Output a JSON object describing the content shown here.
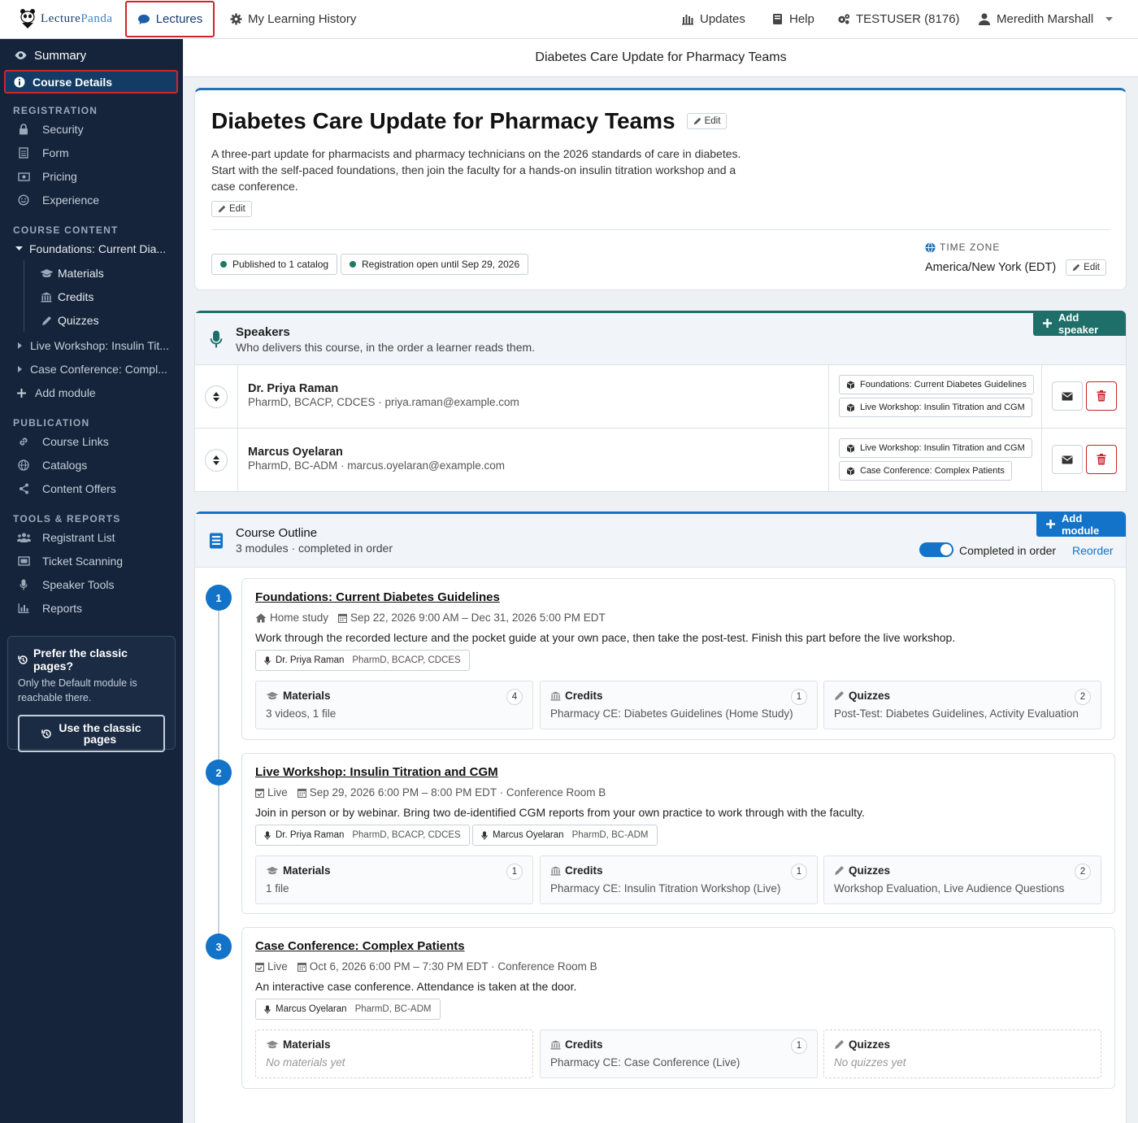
{
  "brand": {
    "logo_a": "Lecture",
    "logo_b": "Panda"
  },
  "topnav": {
    "lectures": "Lectures",
    "history": "My Learning History",
    "updates": "Updates",
    "help": "Help",
    "account": "TESTUSER (8176)",
    "user": "Meredith Marshall"
  },
  "sidebar": {
    "summary": "Summary",
    "course_details": "Course Details",
    "registration_head": "REGISTRATION",
    "registration": [
      "Security",
      "Form",
      "Pricing",
      "Experience"
    ],
    "content_head": "COURSE CONTENT",
    "module1": "Foundations: Current Dia...",
    "module1_children": [
      "Materials",
      "Credits",
      "Quizzes"
    ],
    "module2": "Live Workshop: Insulin Tit...",
    "module3": "Case Conference: Compl...",
    "add_module": "Add module",
    "publication_head": "PUBLICATION",
    "publication": [
      "Course Links",
      "Catalogs",
      "Content Offers"
    ],
    "tools_head": "TOOLS & REPORTS",
    "tools": [
      "Registrant List",
      "Ticket Scanning",
      "Speaker Tools",
      "Reports"
    ],
    "classic_title": "Prefer the classic pages?",
    "classic_desc": "Only the Default module is reachable there.",
    "classic_btn_1": "Use the classic",
    "classic_btn_2": "pages"
  },
  "page_title": "Diabetes Care Update for Pharmacy Teams",
  "course": {
    "title": "Diabetes Care Update for Pharmacy Teams",
    "edit": "Edit",
    "description": "A three-part update for pharmacists and pharmacy technicians on the 2026 standards of care in diabetes. Start with the self-paced foundations, then join the faculty for a hands-on insulin titration workshop and a case conference.",
    "published": "Published to 1 catalog",
    "registration": "Registration open until Sep 29, 2026",
    "tz_label": "TIME ZONE",
    "tz_value": "America/New York (EDT)"
  },
  "speakers": {
    "title": "Speakers",
    "subtitle": "Who delivers this course, in the order a learner reads them.",
    "add": "Add speaker",
    "list": [
      {
        "name": "Dr. Priya Raman",
        "meta": "PharmD, BCACP, CDCES · priya.raman@example.com",
        "modules": [
          "Foundations: Current Diabetes Guidelines",
          "Live Workshop: Insulin Titration and CGM"
        ]
      },
      {
        "name": "Marcus Oyelaran",
        "meta": "PharmD, BC-ADM · marcus.oyelaran@example.com",
        "modules": [
          "Live Workshop: Insulin Titration and CGM",
          "Case Conference: Complex Patients"
        ]
      }
    ]
  },
  "outline": {
    "title": "Course Outline",
    "subtitle": "3 modules · completed in order",
    "add": "Add module",
    "toggle_label": "Completed in order",
    "reorder": "Reorder",
    "modules": [
      {
        "num": "1",
        "title": "Foundations: Current Diabetes Guidelines",
        "type": "Home study",
        "when": "Sep 22, 2026 9:00 AM – Dec 31, 2026 5:00 PM EDT",
        "desc": "Work through the recorded lecture and the pocket guide at your own pace, then take the post-test. Finish this part before the live workshop.",
        "speakers": [
          {
            "name": "Dr. Priya Raman",
            "cred": "PharmD, BCACP, CDCES"
          }
        ],
        "materials": {
          "label": "Materials",
          "count": "4",
          "body": "3 videos, 1 file"
        },
        "credits": {
          "label": "Credits",
          "count": "1",
          "body": "Pharmacy CE: Diabetes Guidelines (Home Study)"
        },
        "quizzes": {
          "label": "Quizzes",
          "count": "2",
          "body": "Post-Test: Diabetes Guidelines, Activity Evaluation"
        }
      },
      {
        "num": "2",
        "title": "Live Workshop: Insulin Titration and CGM",
        "type": "Live",
        "when": "Sep 29, 2026 6:00 PM – 8:00 PM EDT · Conference Room B",
        "desc": "Join in person or by webinar. Bring two de-identified CGM reports from your own practice to work through with the faculty.",
        "speakers": [
          {
            "name": "Dr. Priya Raman",
            "cred": "PharmD, BCACP, CDCES"
          },
          {
            "name": "Marcus Oyelaran",
            "cred": "PharmD, BC-ADM"
          }
        ],
        "materials": {
          "label": "Materials",
          "count": "1",
          "body": "1 file"
        },
        "credits": {
          "label": "Credits",
          "count": "1",
          "body": "Pharmacy CE: Insulin Titration Workshop (Live)"
        },
        "quizzes": {
          "label": "Quizzes",
          "count": "2",
          "body": "Workshop Evaluation, Live Audience Questions"
        }
      },
      {
        "num": "3",
        "title": "Case Conference: Complex Patients",
        "type": "Live",
        "when": "Oct 6, 2026 6:00 PM – 7:30 PM EDT · Conference Room B",
        "desc": "An interactive case conference. Attendance is taken at the door.",
        "speakers": [
          {
            "name": "Marcus Oyelaran",
            "cred": "PharmD, BC-ADM"
          }
        ],
        "materials": {
          "label": "Materials",
          "body": "No materials yet"
        },
        "credits": {
          "label": "Credits",
          "count": "1",
          "body": "Pharmacy CE: Case Conference (Live)"
        },
        "quizzes": {
          "label": "Quizzes",
          "body": "No quizzes yet"
        }
      }
    ]
  },
  "colors": {
    "navy": "#15243a",
    "accent": "#1273c9",
    "teal": "#1e6f6a",
    "danger": "#c8232a",
    "highlight": "#d0242b"
  },
  "icons": {
    "lectures": "speech-bubble-icon",
    "history": "gear-icon",
    "updates": "bars-icon",
    "help": "book-icon",
    "account": "cogs-icon",
    "user": "user-icon",
    "summary": "eye-icon",
    "details": "info-icon",
    "speakers": "microphone-icon",
    "outline": "book-icon",
    "materials": "graduation-cap-icon",
    "credits": "institution-icon",
    "quizzes": "pencil-icon"
  }
}
